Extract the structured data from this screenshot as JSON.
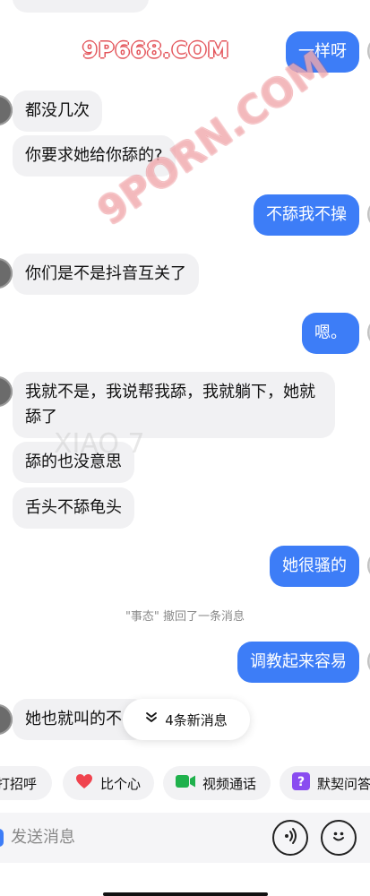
{
  "watermarks": {
    "brand": "9P668.COM",
    "diagonal": "9PORN.COM",
    "faint": "XIAO 7"
  },
  "messages": [
    {
      "side": "out",
      "text": "一样呀"
    },
    {
      "side": "in",
      "text": "都没几次"
    },
    {
      "side": "in",
      "text": "你要求她给你舔的?"
    },
    {
      "side": "out",
      "text": "不舔我不操"
    },
    {
      "side": "in",
      "text": "你们是不是抖音互关了"
    },
    {
      "side": "out",
      "text": "嗯。"
    },
    {
      "side": "in",
      "text": "我就不是，我说帮我舔，我就躺下，她就舔了"
    },
    {
      "side": "in",
      "text": "舔的也没意思"
    },
    {
      "side": "in",
      "text": "舌头不舔龟头"
    },
    {
      "side": "out",
      "text": "她很骚的"
    },
    {
      "side": "out",
      "text": "调教起来容易"
    },
    {
      "side": "in",
      "text": "她也就叫的不"
    }
  ],
  "system_notice": "\"事态\" 撤回了一条消息",
  "new_messages": {
    "label": "4条新消息"
  },
  "quick_actions": [
    {
      "label": "打招呼",
      "icon": "wave-icon"
    },
    {
      "label": "比个心",
      "icon": "heart-icon",
      "color": "#f0434e"
    },
    {
      "label": "视频通话",
      "icon": "video-camera-icon",
      "color": "#1fb14c"
    },
    {
      "label": "默契问答",
      "icon": "question-badge-icon",
      "color": "#8a4cf0"
    }
  ],
  "input": {
    "placeholder": "发送消息"
  },
  "colors": {
    "outgoing_bubble": "#3d7df7",
    "incoming_bubble": "#f1f1f3"
  }
}
